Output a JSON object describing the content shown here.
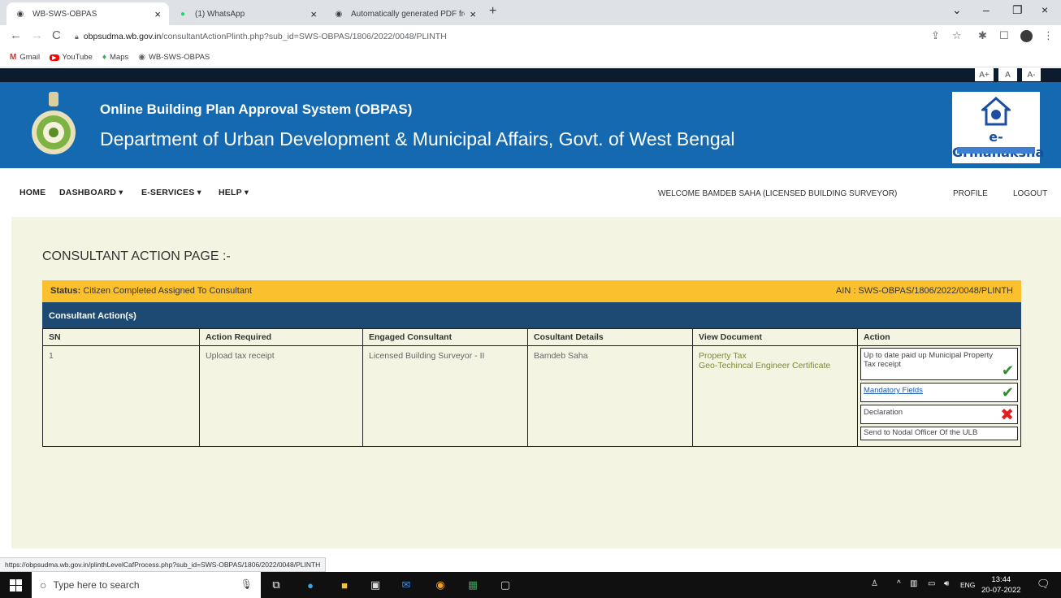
{
  "browser": {
    "tabs": [
      {
        "title": "WB-SWS-OBPAS",
        "close": "×"
      },
      {
        "title": "(1) WhatsApp",
        "close": "×"
      },
      {
        "title": "Automatically generated PDF fro",
        "close": "×"
      }
    ],
    "new_tab": "+",
    "window_controls": {
      "dropdown": "⌄",
      "minimize": "–",
      "restore": "❐",
      "close": "×"
    },
    "nav": {
      "back": "←",
      "forward": "→",
      "reload": "C"
    },
    "url_host": "obpsudma.wb.gov.in",
    "url_path": "/consultantActionPlinth.php?sub_id=SWS-OBPAS/1806/2022/0048/PLINTH",
    "toolbar_icons": {
      "share": "⇪",
      "star": "☆",
      "extensions": "✱",
      "sidebar": "☐",
      "more": "⋮"
    },
    "bookmarks": [
      {
        "label": "Gmail",
        "icon": "M",
        "color": "#d93025"
      },
      {
        "label": "YouTube",
        "icon": "▶",
        "color": "#ff0000"
      },
      {
        "label": "Maps",
        "icon": "♦",
        "color": "#34a853"
      },
      {
        "label": "WB-SWS-OBPAS",
        "icon": "◉",
        "color": "#5f6368"
      }
    ],
    "status_link": "https://obpsudma.wb.gov.in/plinthLevelCafProcess.php?sub_id=SWS-OBPAS/1806/2022/0048/PLINTH"
  },
  "site": {
    "font_controls": [
      "A+",
      "A",
      "A-"
    ],
    "header_line1": "Online Building Plan Approval System (OBPAS)",
    "header_line2": "Department of Urban Development & Municipal Affairs, Govt. of West Bengal",
    "logo_text": "e-Grihanaksha",
    "menu": [
      {
        "label": "HOME"
      },
      {
        "label": "DASHBOARD ▾"
      },
      {
        "label": "E-SERVICES ▾"
      },
      {
        "label": "HELP ▾"
      }
    ],
    "welcome": "WELCOME BAMDEB SAHA (LICENSED BUILDING SURVEYOR)",
    "profile": "PROFILE",
    "logout": "LOGOUT"
  },
  "content": {
    "page_title": "CONSULTANT ACTION PAGE :-",
    "status_label": "Status:",
    "status_value": "Citizen Completed Assigned To Consultant",
    "ain": "AIN : SWS-OBPAS/1806/2022/0048/PLINTH",
    "section_title": "Consultant Action(s)",
    "table": {
      "headers": [
        "SN",
        "Action Required",
        "Engaged Consultant",
        "Cosultant Details",
        "View Document",
        "Action"
      ],
      "rows": [
        {
          "sn": "1",
          "action_required": "Upload tax receipt",
          "engaged_consultant": "Licensed Building Surveyor - II",
          "consultant_details": "Bamdeb Saha",
          "documents": [
            "Property Tax",
            "Geo-Techincal Engineer Certificate"
          ],
          "actions": [
            {
              "label": "Up to date paid up Municipal Property Tax receipt",
              "state": "done",
              "mark": "✔"
            },
            {
              "label": "Mandatory Fields",
              "state": "done",
              "mark": "✔"
            },
            {
              "label": "Declaration",
              "state": "pending",
              "mark": "✖"
            },
            {
              "label": "Send to Nodal Officer Of the ULB",
              "state": "none",
              "mark": ""
            }
          ]
        }
      ]
    }
  },
  "taskbar": {
    "search_placeholder": "Type here to search",
    "tray_text": "ENG",
    "time": "13:44",
    "date": "20-07-2022"
  }
}
